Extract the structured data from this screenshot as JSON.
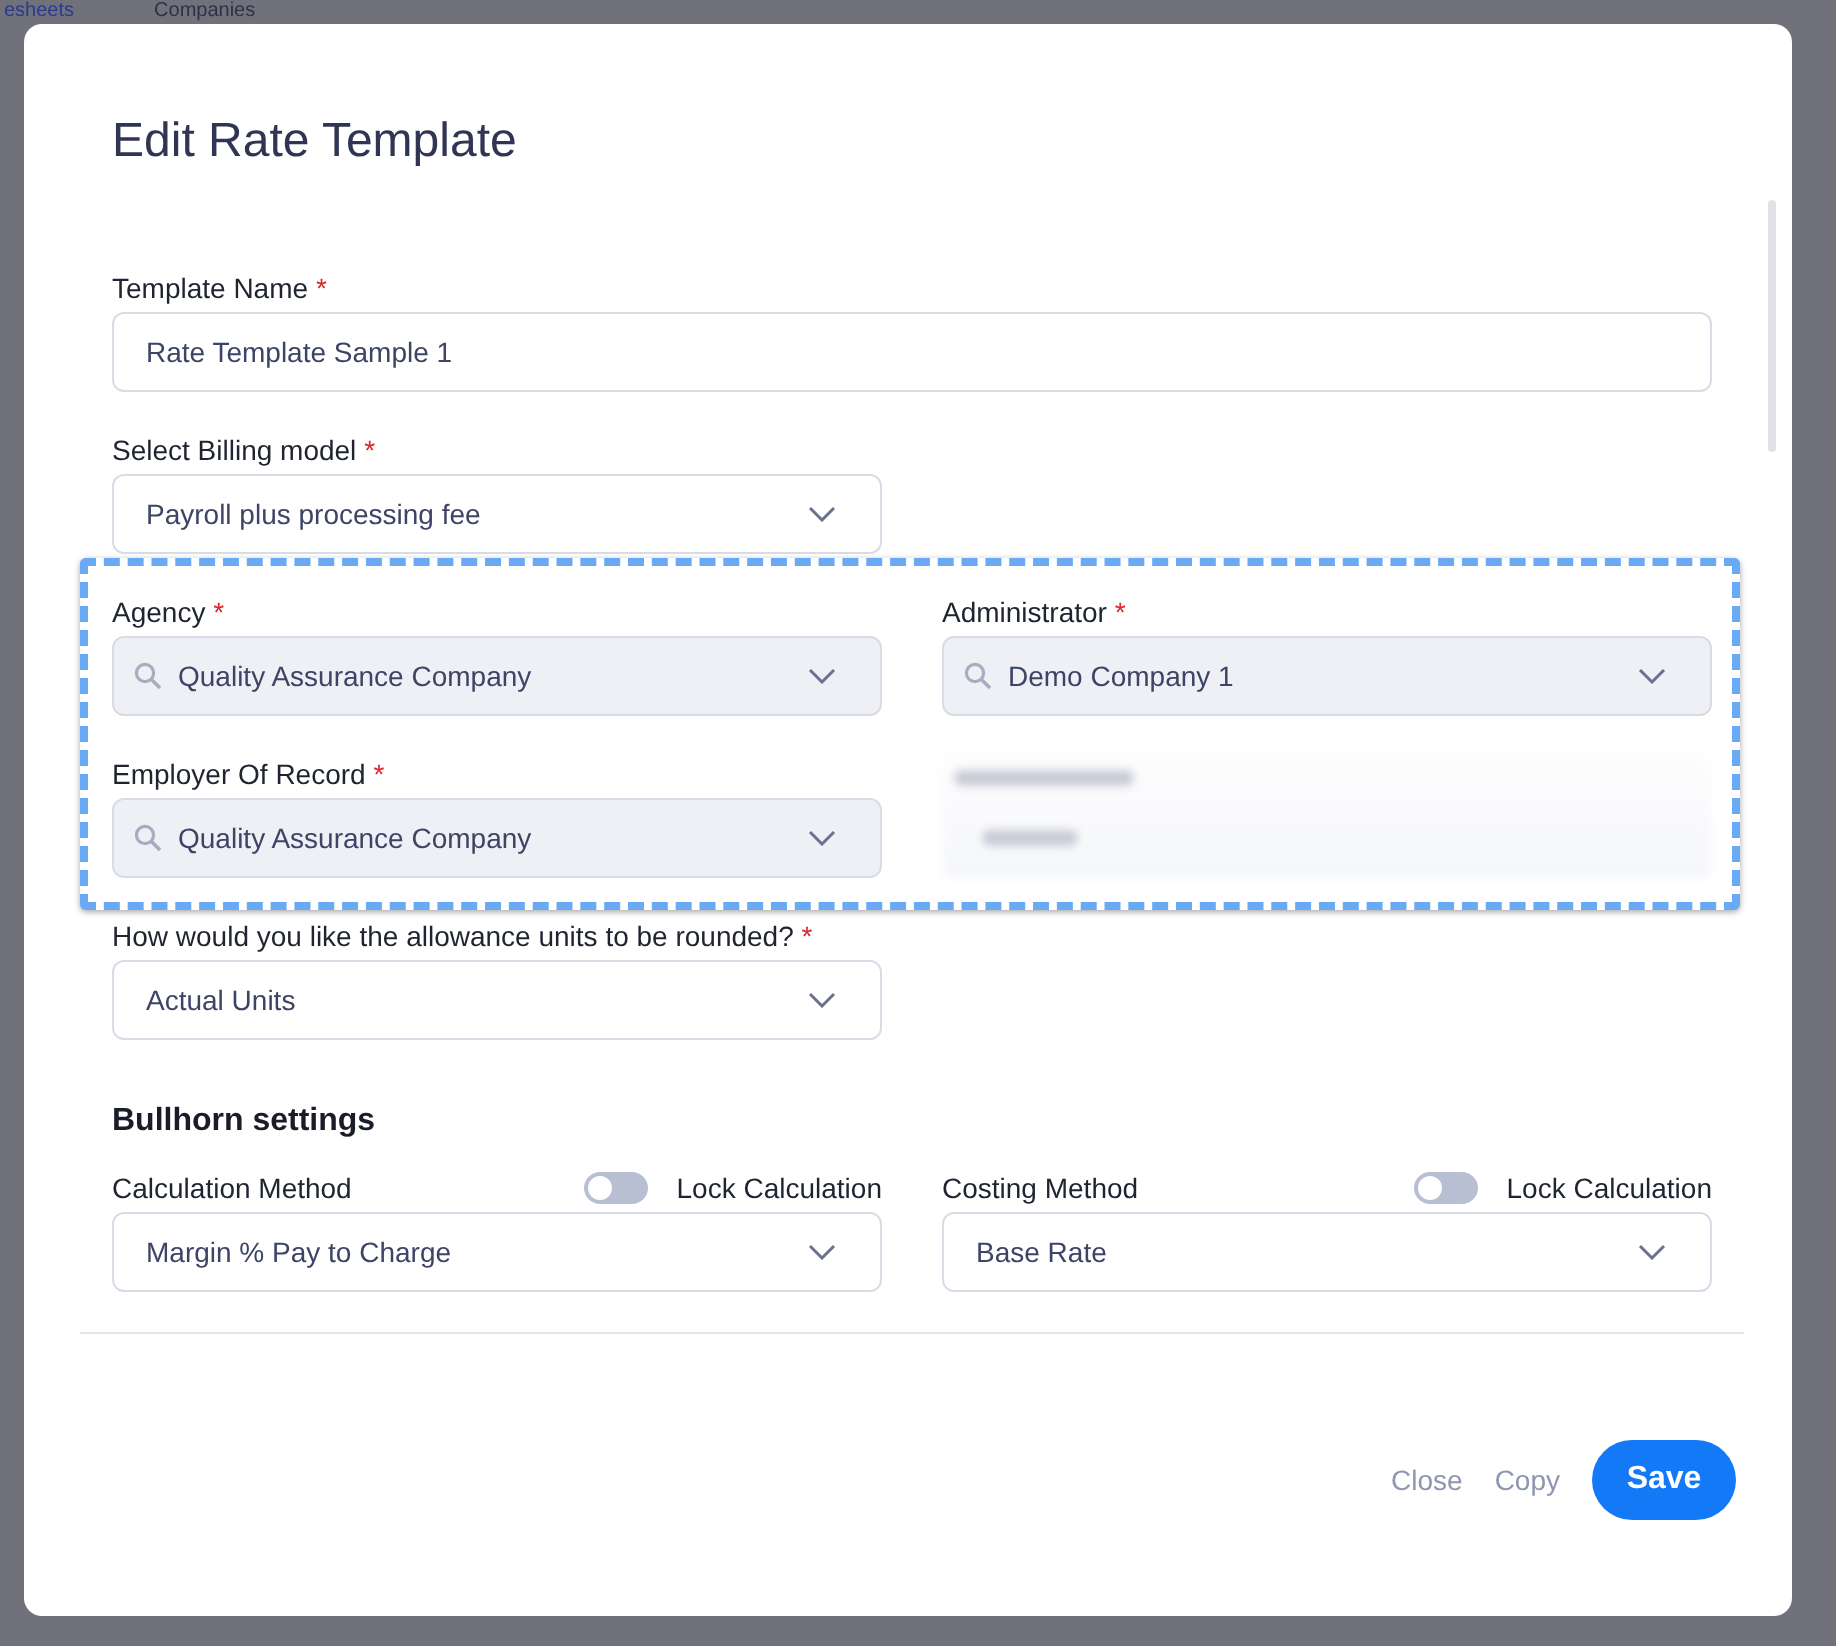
{
  "background": {
    "tabs": [
      {
        "label": "esheets",
        "selected": true
      },
      {
        "label": "Companies",
        "selected": false
      }
    ]
  },
  "title": "Edit Rate Template",
  "template_name": {
    "label": "Template Name",
    "required_mark": "*",
    "value": "Rate Template Sample 1"
  },
  "billing_model": {
    "label": "Select Billing model",
    "required_mark": "*",
    "value": "Payroll plus processing fee"
  },
  "party_fields": [
    {
      "kind": "search",
      "label": "Agency",
      "required_mark": "*",
      "value": "Quality Assurance Company"
    },
    {
      "kind": "search",
      "label": "Administrator",
      "required_mark": "*",
      "value": "Demo Company 1"
    },
    {
      "kind": "search",
      "label": "Employer Of Record",
      "required_mark": "*",
      "value": "Quality Assurance Company"
    },
    {
      "kind": "blurred"
    }
  ],
  "rounding": {
    "label": "How would you like the allowance units to be rounded?",
    "required_mark": "*",
    "value": "Actual Units"
  },
  "bullhorn": {
    "heading": "Bullhorn settings",
    "methods": [
      {
        "label": "Calculation Method",
        "lock_label": "Lock Calculation",
        "locked": false,
        "value": "Margin % Pay to Charge"
      },
      {
        "label": "Costing Method",
        "lock_label": "Lock Calculation",
        "locked": false,
        "value": "Base Rate"
      }
    ]
  },
  "buttons": [
    {
      "kind": "link",
      "label": "Close"
    },
    {
      "kind": "link",
      "label": "Copy"
    },
    {
      "kind": "primary",
      "label": "Save"
    }
  ]
}
